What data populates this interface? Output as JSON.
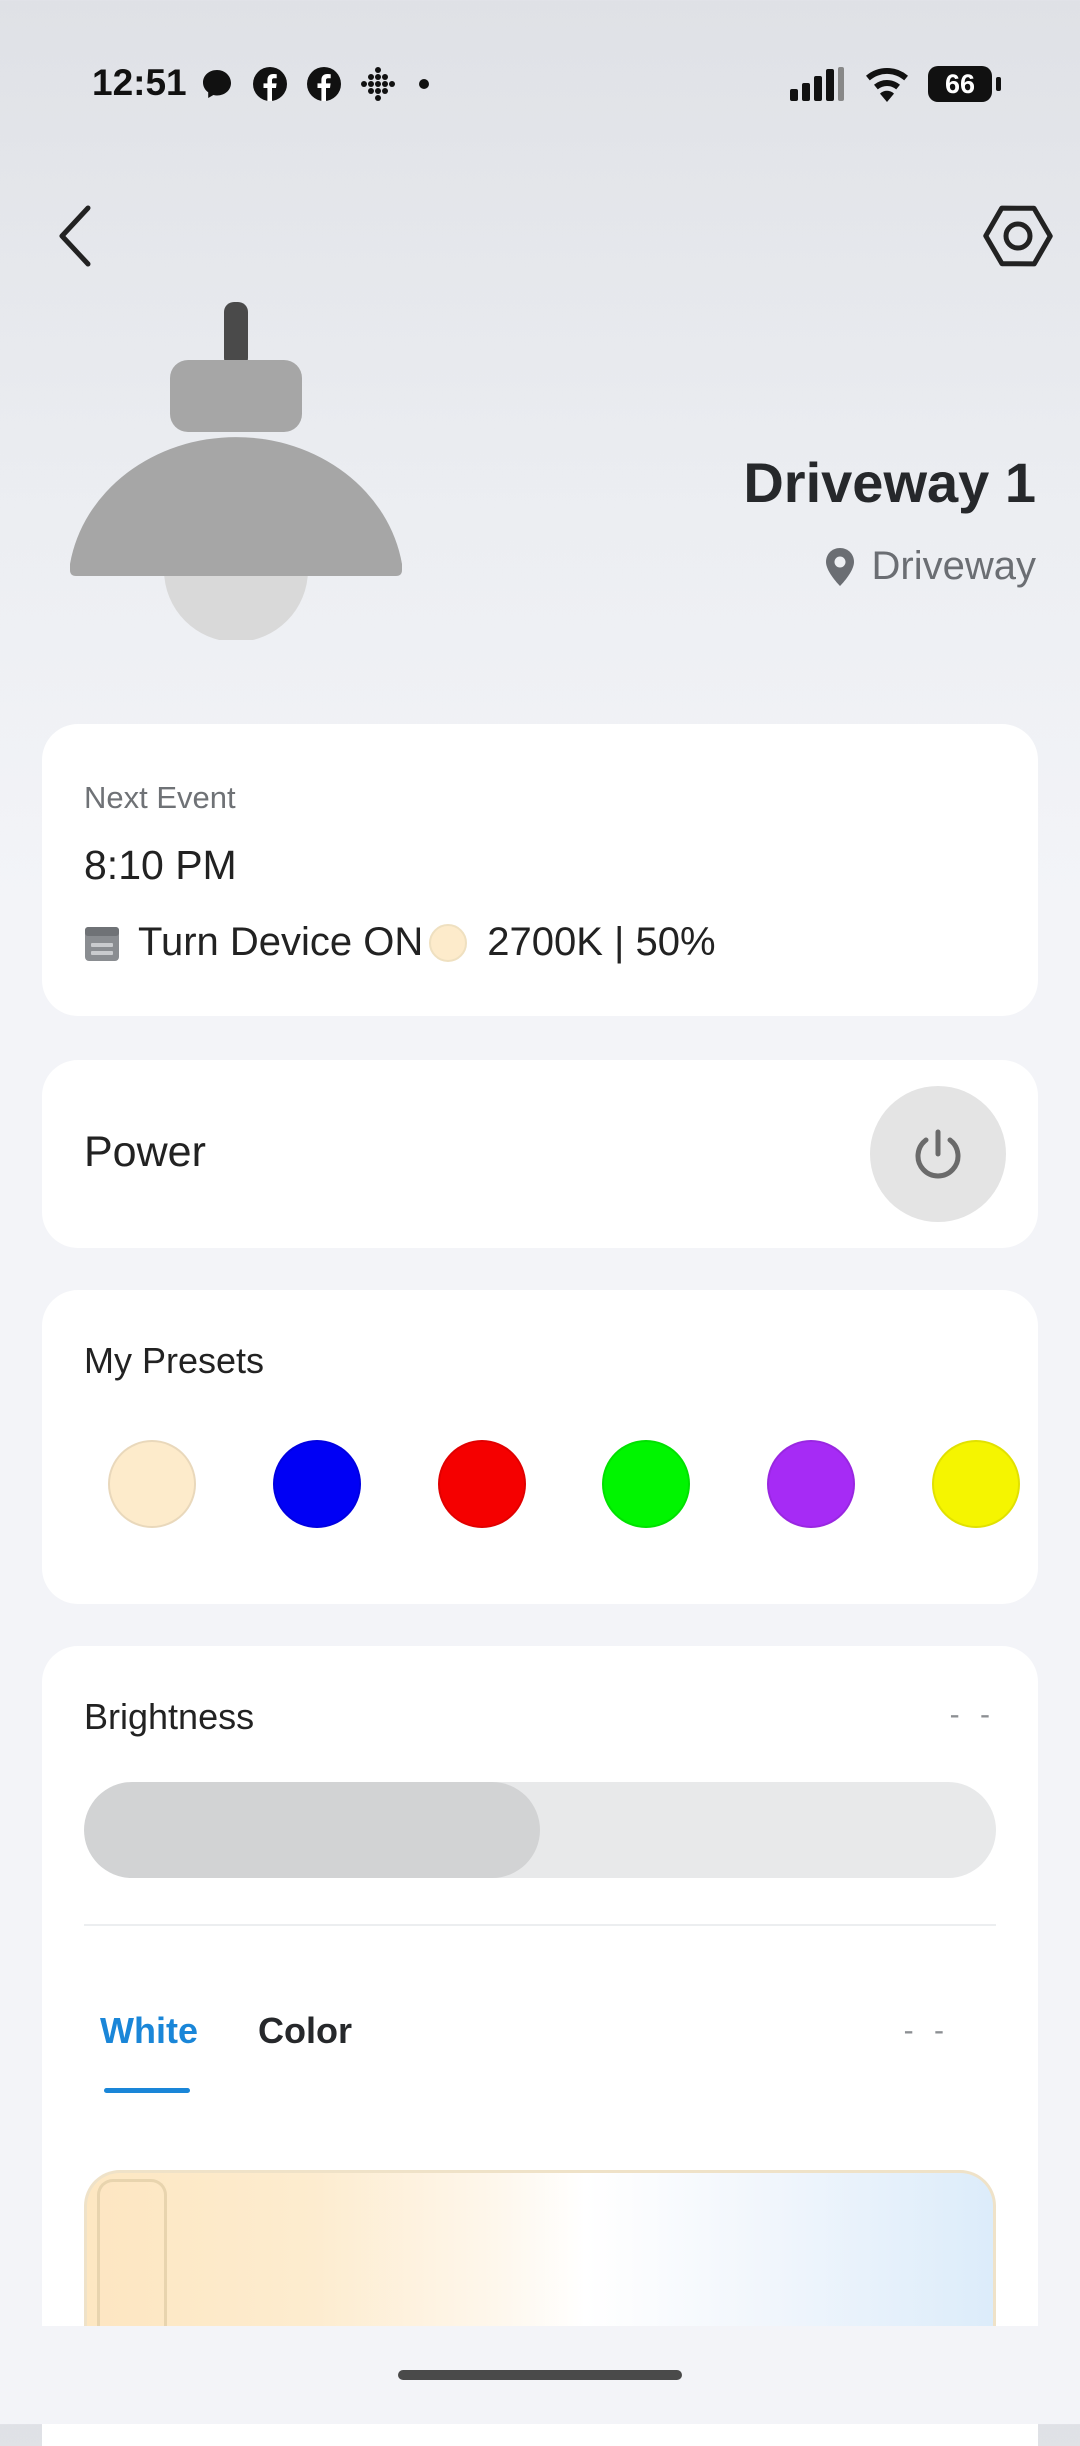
{
  "status_bar": {
    "time": "12:51",
    "left_icons": [
      "messenger-icon",
      "facebook-icon",
      "facebook-icon",
      "dots-grid-icon",
      "dot-icon"
    ],
    "right_icons": [
      "cellular-signal-icon",
      "wifi-icon",
      "battery-icon"
    ],
    "battery_level": "66"
  },
  "header": {
    "back_icon": "chevron-left-icon",
    "settings_icon": "hexagon-settings-icon",
    "device_name": "Driveway 1",
    "location_icon": "location-pin-icon",
    "location": "Driveway"
  },
  "next_event": {
    "label": "Next Event",
    "time": "8:10 PM",
    "action_icon": "calendar-icon",
    "action": "Turn Device ON",
    "color_swatch": "#fdebcb",
    "setting": "2700K | 50%"
  },
  "power": {
    "label": "Power",
    "icon": "power-icon"
  },
  "presets": {
    "label": "My Presets",
    "colors": [
      "#fdebcb",
      "#0000f5",
      "#f50000",
      "#00f500",
      "#a62bf5",
      "#f5f500"
    ]
  },
  "brightness": {
    "label": "Brightness",
    "value": "- -",
    "level_fraction": 0.5
  },
  "mode_tabs": {
    "white": "White",
    "color": "Color",
    "value": "- -",
    "active": "White",
    "accent": "#1a86d8"
  }
}
